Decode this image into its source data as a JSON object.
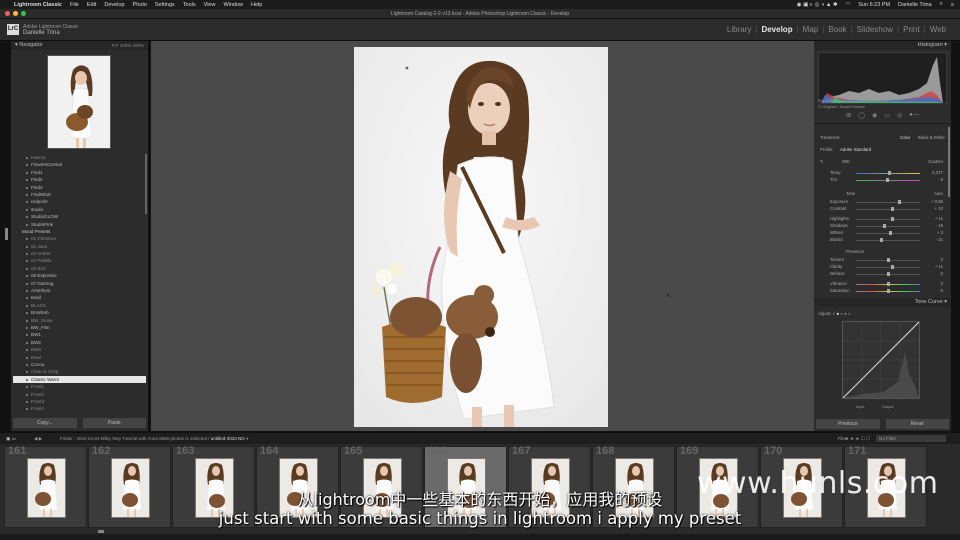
{
  "menubar": {
    "app_name": "Lightroom Classic",
    "items": [
      "File",
      "Edit",
      "Develop",
      "Photo",
      "Settings",
      "Tools",
      "View",
      "Window",
      "Help"
    ],
    "clock": "Sun 6:23 PM",
    "user": "Danielle Trina"
  },
  "window": {
    "title": "Lightroom Catalog-2-2-v13.lrcat - Adobe Photoshop Lightroom Classic - Develop"
  },
  "identity": {
    "logo": "LrC",
    "line1": "Adobe Lightroom Classic",
    "line2": "Danielle Trina"
  },
  "modules": [
    {
      "label": "Library",
      "active": false
    },
    {
      "label": "Develop",
      "active": true
    },
    {
      "label": "Map",
      "active": false
    },
    {
      "label": "Book",
      "active": false
    },
    {
      "label": "Slideshow",
      "active": false
    },
    {
      "label": "Print",
      "active": false
    },
    {
      "label": "Web",
      "active": false
    }
  ],
  "left_panel": {
    "navigator_title": "Navigator",
    "navigator_options": "FIT   100%   200%",
    "presets": [
      {
        "label": "Haircut",
        "kind": "dim"
      },
      {
        "label": "FlowersCentral",
        "kind": "item"
      },
      {
        "label": "Find1",
        "kind": "item"
      },
      {
        "label": "Find2",
        "kind": "item"
      },
      {
        "label": "Find3",
        "kind": "item"
      },
      {
        "label": "FindNEW",
        "kind": "item"
      },
      {
        "label": "redpoint",
        "kind": "item"
      },
      {
        "label": "studio",
        "kind": "item"
      },
      {
        "label": "StudioGLOW",
        "kind": "item"
      },
      {
        "label": "StudioPink",
        "kind": "item"
      },
      {
        "label": "Mood Presets",
        "kind": "group"
      },
      {
        "label": "01 Chestnut",
        "kind": "dim"
      },
      {
        "label": "02 Java",
        "kind": "dim"
      },
      {
        "label": "03 Amber",
        "kind": "dim"
      },
      {
        "label": "04 Pebble",
        "kind": "dim"
      },
      {
        "label": "05 Bird",
        "kind": "dim"
      },
      {
        "label": "06 Espresso",
        "kind": "item"
      },
      {
        "label": "07 Nutmeg",
        "kind": "item"
      },
      {
        "label": "Amethyst",
        "kind": "item"
      },
      {
        "label": "Basil",
        "kind": "item"
      },
      {
        "label": "BLACK",
        "kind": "dim"
      },
      {
        "label": "BnWbnb",
        "kind": "item"
      },
      {
        "label": "BW_Snow",
        "kind": "dim"
      },
      {
        "label": "BW_Film",
        "kind": "item"
      },
      {
        "label": "BW1",
        "kind": "item"
      },
      {
        "label": "BW2",
        "kind": "item"
      },
      {
        "label": "BW3",
        "kind": "dim"
      },
      {
        "label": "Bowl",
        "kind": "dim"
      },
      {
        "label": "Cocoa",
        "kind": "item"
      },
      {
        "label": "Clear & Crisp",
        "kind": "dim"
      },
      {
        "label": "Classic Warm",
        "kind": "selected"
      },
      {
        "label": "Frost1",
        "kind": "dim"
      },
      {
        "label": "Frost2",
        "kind": "dim"
      },
      {
        "label": "Frost3",
        "kind": "dim"
      },
      {
        "label": "Frost4",
        "kind": "dim"
      }
    ],
    "copy_label": "Copy...",
    "paste_label": "Paste"
  },
  "right_panel": {
    "histogram_title": "Histogram",
    "histogram_info": "ISO 320   50 mm   f/2.8   1/200 sec",
    "original_label": "Original + Smart Preview",
    "treatment_label": "Treatment:",
    "color_label": "Color",
    "bw_label": "Black & White",
    "profile_label": "Profile:",
    "profile_value": "Adobe Standard",
    "wb_label": "WB:",
    "wb_value": "Custom",
    "temp_label": "Temp",
    "temp_value": "6,377",
    "tint_label": "Tint",
    "tint_value": "- 8",
    "tone_label": "Tone",
    "auto_label": "Auto",
    "exposure_label": "Exposure",
    "exposure_value": "+ 0.86",
    "contrast_label": "Contrast",
    "contrast_value": "+ 10",
    "highlights_label": "Highlights",
    "highlights_value": "+ 11",
    "shadows_label": "Shadows",
    "shadows_value": "- 16",
    "whites_label": "Whites",
    "whites_value": "+ 3",
    "blacks_label": "Blacks",
    "blacks_value": "- 21",
    "presence_label": "Presence",
    "texture_label": "Texture",
    "texture_value": "0",
    "clarity_label": "Clarity",
    "clarity_value": "+ 11",
    "dehaze_label": "Dehaze",
    "dehaze_value": "0",
    "vibrance_label": "Vibrance",
    "vibrance_value": "0",
    "saturation_label": "Saturation",
    "saturation_value": "0",
    "tone_curve_title": "Tone Curve",
    "adjust_label": "Adjust:",
    "input_label": "Input",
    "output_label": "Output",
    "previous_label": "Previous",
    "reset_label": "Reset"
  },
  "filmstrip_bar": {
    "folder_text": "Folder : 2022-04-23 Milky Way Tutorial with Anna",
    "count_text": "5686 photos /1 selected /",
    "file_name": "untitled-3310.NG",
    "filter_label": "Filter :",
    "no_filter": "No Filter"
  },
  "filmstrip": [
    {
      "num": "161",
      "selected": false
    },
    {
      "num": "162",
      "selected": false
    },
    {
      "num": "163",
      "selected": false
    },
    {
      "num": "164",
      "selected": false
    },
    {
      "num": "165",
      "selected": false
    },
    {
      "num": "166",
      "selected": true
    },
    {
      "num": "167",
      "selected": false
    },
    {
      "num": "168",
      "selected": false
    },
    {
      "num": "169",
      "selected": false
    },
    {
      "num": "170",
      "selected": false
    },
    {
      "num": "171",
      "selected": false
    }
  ],
  "subtitles": {
    "chinese": "从lightroom中一些基本的东西开始，应用我的预设",
    "english": "just start with some basic things in lightroom i apply my preset"
  },
  "watermark": "www.hunls.com"
}
